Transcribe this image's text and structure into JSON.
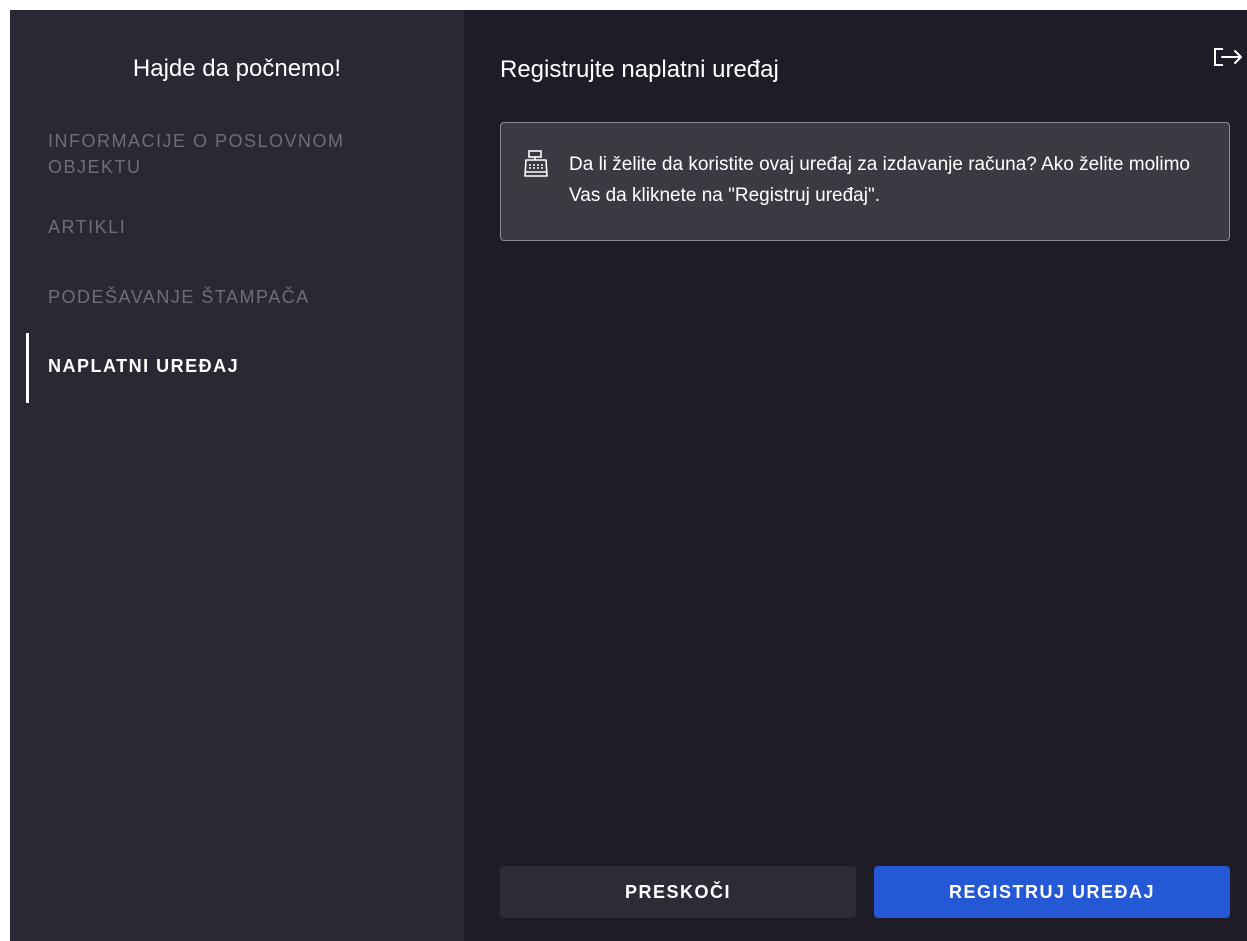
{
  "sidebar": {
    "title": "Hajde da počnemo!",
    "steps": [
      {
        "label": "INFORMACIJE O POSLOVNOM OBJEKTU",
        "active": false
      },
      {
        "label": "ARTIKLI",
        "active": false
      },
      {
        "label": "PODEŠAVANJE ŠTAMPAČA",
        "active": false
      },
      {
        "label": "NAPLATNI UREĐAJ",
        "active": true
      }
    ]
  },
  "main": {
    "title": "Registrujte naplatni uređaj",
    "logout_icon": "logout-icon",
    "info": {
      "icon": "cash-register-icon",
      "text": "Da li želite da koristite ovaj uređaj za izdavanje računa? Ako želite molimo Vas da kliknete na \"Registruj uređaj\"."
    },
    "buttons": {
      "skip_label": "PRESKOČI",
      "register_label": "REGISTRUJ UREĐAJ"
    }
  },
  "colors": {
    "sidebar_bg": "#292833",
    "main_bg": "#1e1d27",
    "accent": "#2558d4",
    "inactive_text": "#6e6d78"
  }
}
